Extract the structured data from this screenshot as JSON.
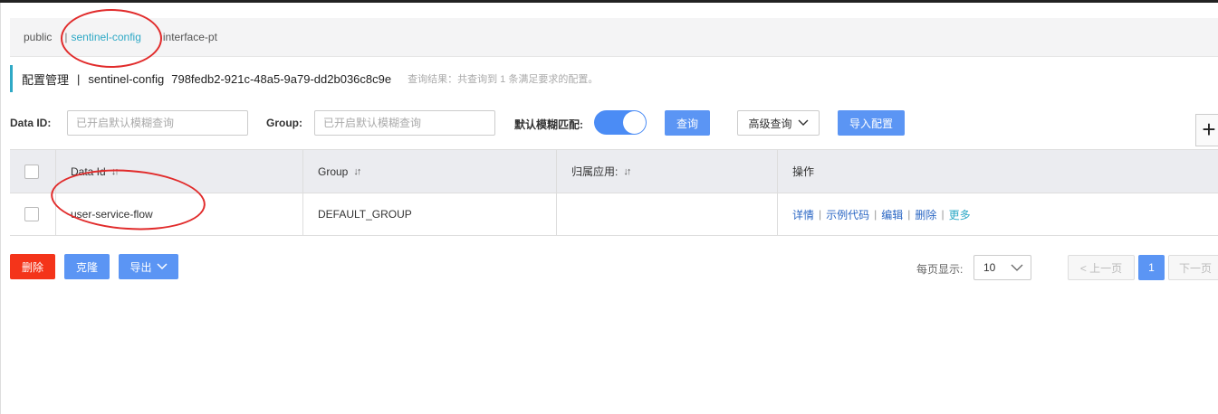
{
  "namespaces": [
    {
      "label": "public"
    },
    {
      "label": "sentinel-config"
    },
    {
      "label": "interface-pt"
    }
  ],
  "namespace_separator": "|",
  "title": {
    "label": "配置管理",
    "separator": "|",
    "namespace_name": "sentinel-config",
    "namespace_id": "798fedb2-921c-48a5-9a79-dd2b036c8c9e",
    "result": "查询结果：共查询到 1 条满足要求的配置。"
  },
  "search": {
    "data_id_label": "Data ID:",
    "data_id_placeholder": "已开启默认模糊查询",
    "group_label": "Group:",
    "group_placeholder": "已开启默认模糊查询",
    "fuzzy_label": "默认模糊匹配:",
    "fuzzy_enabled": true,
    "query_button": "查询",
    "advanced_button": "高级查询",
    "import_button": "导入配置"
  },
  "plus_icon": "plus-icon",
  "table": {
    "headers": [
      "Data Id",
      "Group",
      "归属应用:",
      "操作"
    ],
    "sort_glyph": "↓↑",
    "rows": [
      {
        "data_id": "user-service-flow",
        "group": "DEFAULT_GROUP",
        "app": ""
      }
    ],
    "ops": [
      "详情",
      "示例代码",
      "编辑",
      "删除",
      "更多"
    ],
    "ops_separator": "|"
  },
  "actions": {
    "delete": "删除",
    "clone": "克隆",
    "export": "导出"
  },
  "pagination": {
    "page_size_label": "每页显示:",
    "page_size": "10",
    "prev": "< 上一页",
    "current": "1",
    "next": "下一页"
  },
  "colors": {
    "accent": "#2fa9c6",
    "primary_button": "#5b95f4",
    "danger_button": "#f4341a",
    "link": "#2b67c4",
    "annotation": "#e12b2b"
  }
}
